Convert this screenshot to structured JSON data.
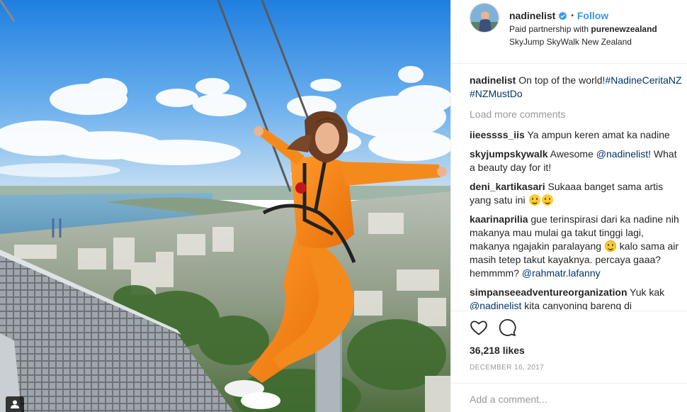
{
  "post": {
    "username": "nadinelist",
    "follow_label": "Follow",
    "dot": "•",
    "partnership_prefix": "Paid partnership with ",
    "partner": "purenewzealand",
    "location": "SkyJump SkyWalk New Zealand"
  },
  "caption": {
    "username": "nadinelist",
    "text": " On top of the world!",
    "hashtags": "#NadineCeritaNZ #NZMustDo"
  },
  "load_more": "Load more comments",
  "comments": [
    {
      "username": "iieessss_iis",
      "text": " Ya ampun keren amat ka nadine"
    },
    {
      "username": "skyjumpskywalk",
      "text_before": " Awesome ",
      "mention": "@nadinelist",
      "text_after": "! What a beauty day for it!"
    },
    {
      "username": "deni_kartikasari",
      "text": " Sukaaa banget sama artis yang satu ini "
    },
    {
      "username": "kaarinaprilia",
      "text_before": " gue terinspirasi dari ka nadine nih makanya mau mulai ga takut tinggi lagi, makanya ngajakin paralayang ",
      "text_after": " kalo sama air masih tetep takut kayaknya. percaya gaaa? hemmmm? ",
      "mention": "@rahmatr.lafanny"
    },
    {
      "username": "simpanseeadventureorganization",
      "text_before": " Yuk kak ",
      "mention": "@nadinelist",
      "text_after": " kita canyoning bareng di"
    }
  ],
  "likes": "36,218 likes",
  "date": "DECEMBER 16, 2017",
  "add_comment_placeholder": "Add a comment...",
  "icons": {
    "like": "heart-icon",
    "comment": "comment-icon",
    "verified": "verified-badge-icon",
    "user_tag": "person-icon"
  },
  "colors": {
    "follow_blue": "#3897f0",
    "mention": "#003569",
    "muted": "#999999",
    "text": "#262626"
  }
}
